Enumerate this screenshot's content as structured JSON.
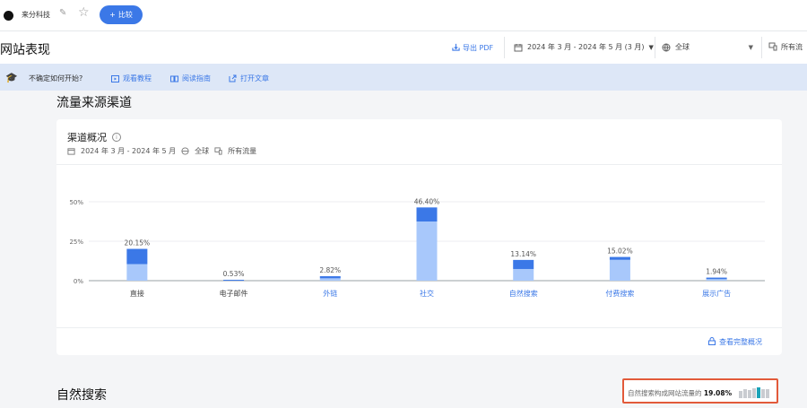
{
  "topbar": {
    "site_name": "来分科技",
    "compare_label": "比较",
    "compare_icon": "+"
  },
  "header": {
    "page_title": "网站表现",
    "export_label": "导出 PDF",
    "date_range": "2024 年 3 月 - 2024 年 5 月 (3 月)",
    "region": "全球",
    "traffic_type": "所有流"
  },
  "help": {
    "question": "不确定如何开始?",
    "links": [
      "观看教程",
      "阅读指南",
      "打开文章"
    ]
  },
  "section1": {
    "title": "流量来源渠道"
  },
  "card": {
    "title": "渠道概况",
    "meta_date": "2024 年 3 月 - 2024 年 5 月",
    "meta_region": "全球",
    "meta_traffic": "所有流量",
    "footer_link": "查看完整概况"
  },
  "chart_data": {
    "type": "bar",
    "categories": [
      "直接",
      "电子邮件",
      "外链",
      "社交",
      "自然搜索",
      "付费搜索",
      "展示广告"
    ],
    "values": [
      20.15,
      0.53,
      2.82,
      46.4,
      13.14,
      15.02,
      1.94
    ],
    "labels": [
      "20.15%",
      "0.53%",
      "2.82%",
      "46.40%",
      "13.14%",
      "15.02%",
      "1.94%"
    ],
    "light_portion": [
      10.5,
      0.53,
      1.5,
      37.5,
      7.4,
      13.2,
      1.0
    ],
    "ytick_labels": [
      "50%",
      "25%",
      "0%"
    ],
    "ylim": [
      0,
      50
    ],
    "colors": {
      "dark": "#3b78e7",
      "light": "#a8c8fb"
    },
    "title": "",
    "xlabel": "",
    "ylabel": ""
  },
  "section2": {
    "title": "自然搜索"
  },
  "share": {
    "text": "自然搜索构成网站流量的",
    "value": "19.08%"
  },
  "mini_bars": {
    "heights": [
      0.7,
      0.8,
      0.75,
      0.9,
      1.0,
      0.85,
      0.8
    ],
    "highlight_index": 4,
    "base_color": "#c9ccd1",
    "highlight_color": "#1aa3b8"
  }
}
